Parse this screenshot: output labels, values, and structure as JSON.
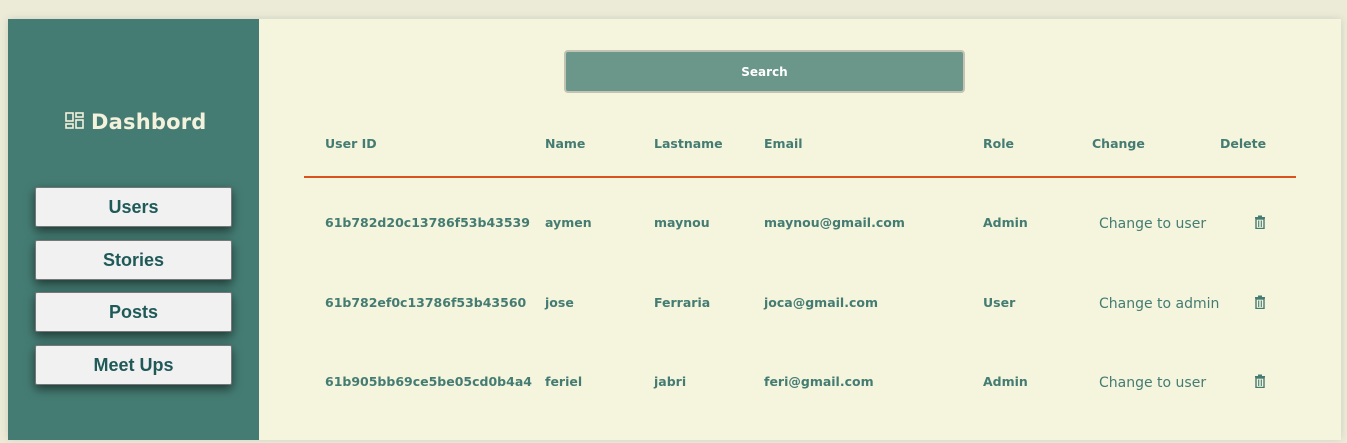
{
  "sidebar": {
    "brand": "Dashbord",
    "brand_icon": "dashboard-grid-icon",
    "items": [
      {
        "label": "Users"
      },
      {
        "label": "Stories"
      },
      {
        "label": "Posts"
      },
      {
        "label": "Meet Ups"
      }
    ]
  },
  "search": {
    "label": "Search"
  },
  "table": {
    "headers": [
      "User ID",
      "Name",
      "Lastname",
      "Email",
      "Role",
      "Change",
      "Delete"
    ],
    "rows": [
      {
        "id": "61b782d20c13786f53b43539",
        "name": "aymen",
        "lastname": "maynou",
        "email": "maynou@gmail.com",
        "role": "Admin",
        "change": "Change to user"
      },
      {
        "id": "61b782ef0c13786f53b43560",
        "name": "jose",
        "lastname": "Ferraria",
        "email": "joca@gmail.com",
        "role": "User",
        "change": "Change to admin"
      },
      {
        "id": "61b905bb69ce5be05cd0b4a4",
        "name": "feriel",
        "lastname": "jabri",
        "email": "feri@gmail.com",
        "role": "Admin",
        "change": "Change to user"
      }
    ]
  },
  "colors": {
    "sidebar": "#447c73",
    "main_bg": "#f5f4dc",
    "accent_line": "#d9531e",
    "search_bg": "#6a978a",
    "text": "#447c73"
  },
  "icons": {
    "delete": "trash-icon"
  }
}
